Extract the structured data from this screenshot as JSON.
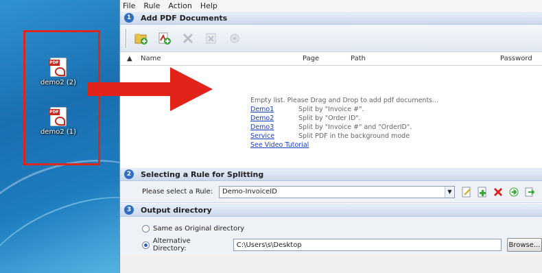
{
  "desktop": {
    "icons": [
      {
        "label": "demo2 (2)",
        "icon": "pdf-file-icon"
      },
      {
        "label": "demo2 (1)",
        "icon": "pdf-file-icon"
      }
    ],
    "accent": "#e0251c"
  },
  "menu": {
    "file": "File",
    "rule": "Rule",
    "action": "Action",
    "help": "Help"
  },
  "sections": {
    "add": {
      "number": "1",
      "title": "Add PDF Documents"
    },
    "rule": {
      "number": "2",
      "title": "Selecting a Rule for Splitting"
    },
    "output": {
      "number": "3",
      "title": "Output directory"
    }
  },
  "toolbar": {
    "buttons": [
      "add-folder-icon",
      "add-pdf-icon",
      "remove-icon",
      "remove-all-icon",
      "settings-icon"
    ]
  },
  "list": {
    "columns": [
      "Name",
      "Page",
      "Path",
      "Password"
    ],
    "empty_message": "Empty list. Please Drag and Drop to add pdf documents...",
    "links": [
      {
        "text": "Demo1",
        "desc": "Split by \"Invoice #\"."
      },
      {
        "text": "Demo2",
        "desc": "Split by \"Order ID\"."
      },
      {
        "text": "Demo3",
        "desc": "Split by \"Invoice #\" and \"OrderID\"."
      },
      {
        "text": "Service",
        "desc": "Split PDF in the background mode"
      }
    ],
    "video_link": "See Video Tutorial"
  },
  "rule_select": {
    "label": "Please select a Rule:",
    "value": "Demo-InvoiceID"
  },
  "output": {
    "same_label": "Same as Original directory",
    "alt_label": "Alternative Directory:",
    "alt_value": "C:\\Users\\s\\Desktop",
    "browse": "Browse..."
  },
  "colors": {
    "section_number": "#2f6ec0",
    "link": "#1a3fbf"
  }
}
